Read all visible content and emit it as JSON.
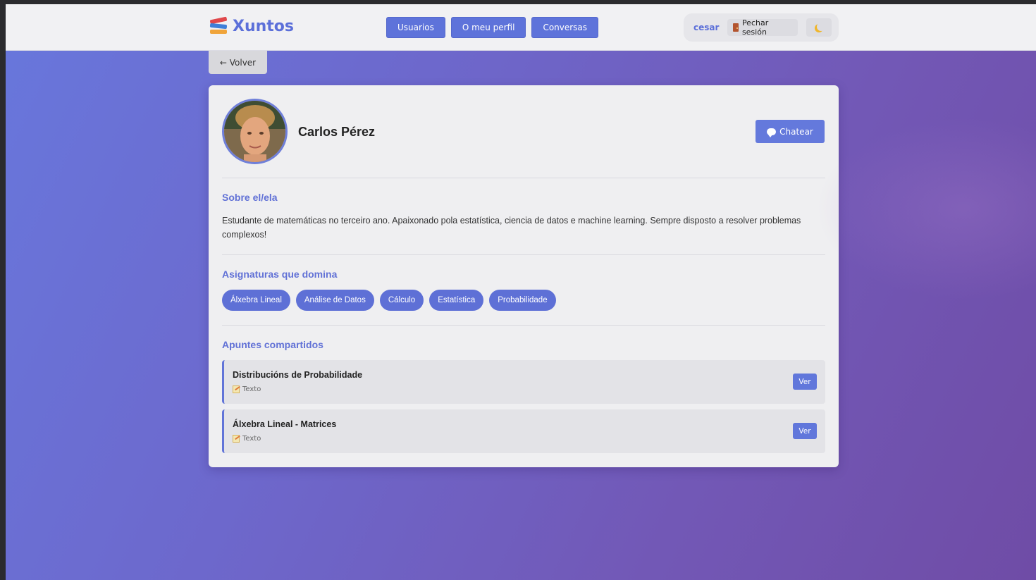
{
  "header": {
    "app_name": "Xuntos",
    "nav": [
      {
        "label": "Usuarios"
      },
      {
        "label": "O meu perfil"
      },
      {
        "label": "Conversas"
      }
    ],
    "username": "cesar",
    "logout_label": "Pechar sesión"
  },
  "back_label": "← Volver",
  "profile": {
    "name": "Carlos Pérez",
    "chat_label": "Chatear"
  },
  "about": {
    "title": "Sobre el/ela",
    "text": "Estudante de matemáticas no terceiro ano. Apaixonado pola estatística, ciencia de datos e machine learning. Sempre disposto a resolver problemas complexos!"
  },
  "subjects": {
    "title": "Asignaturas que domina",
    "items": [
      "Álxebra Lineal",
      "Análise de Datos",
      "Cálculo",
      "Estatística",
      "Probabilidade"
    ]
  },
  "notes": {
    "title": "Apuntes compartidos",
    "items": [
      {
        "title": "Distribucións de Probabilidade",
        "type": "Texto",
        "action": "Ver"
      },
      {
        "title": "Álxebra Lineal - Matrices",
        "type": "Texto",
        "action": "Ver"
      }
    ]
  }
}
